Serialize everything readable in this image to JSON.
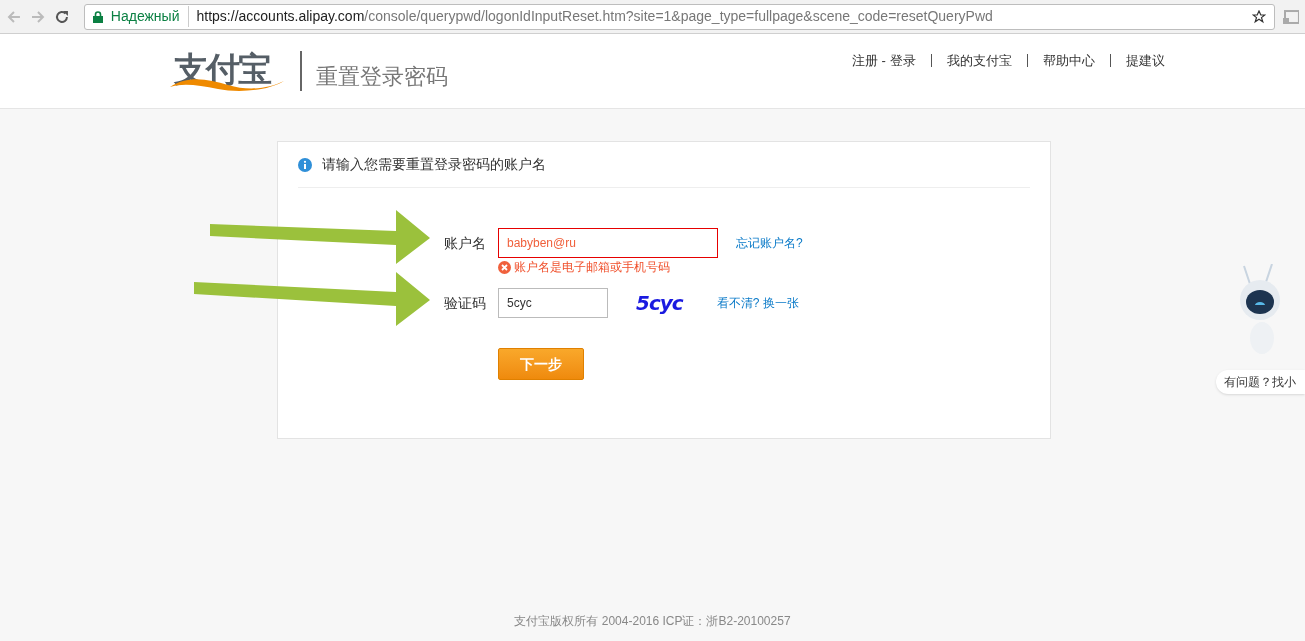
{
  "browser": {
    "security_label": "Надежный",
    "url_host": "https://accounts.alipay.com",
    "url_path": "/console/querypwd/logonIdInputReset.htm?site=1&page_type=fullpage&scene_code=resetQueryPwd"
  },
  "header": {
    "logo": "支付宝",
    "title": "重置登录密码",
    "nav": [
      "注册 - 登录",
      "我的支付宝",
      "帮助中心",
      "提建议"
    ]
  },
  "form": {
    "heading": "请输入您需要重置登录密码的账户名",
    "fields": [
      {
        "kind": "account",
        "label": "账户名",
        "value": "babyben@ru",
        "invalid": true,
        "error": "账户名是电子邮箱或手机号码",
        "link": "忘记账户名?"
      },
      {
        "kind": "captcha",
        "label": "验证码",
        "value": "5cyc",
        "invalid": false,
        "captcha_text": "5cyc",
        "link": "看不清? 换一张"
      }
    ],
    "submit": "下一步"
  },
  "helper": {
    "bubble": "有问题？找小"
  },
  "footer": "支付宝版权所有 2004-2016 ICP证：浙B2-20100257"
}
